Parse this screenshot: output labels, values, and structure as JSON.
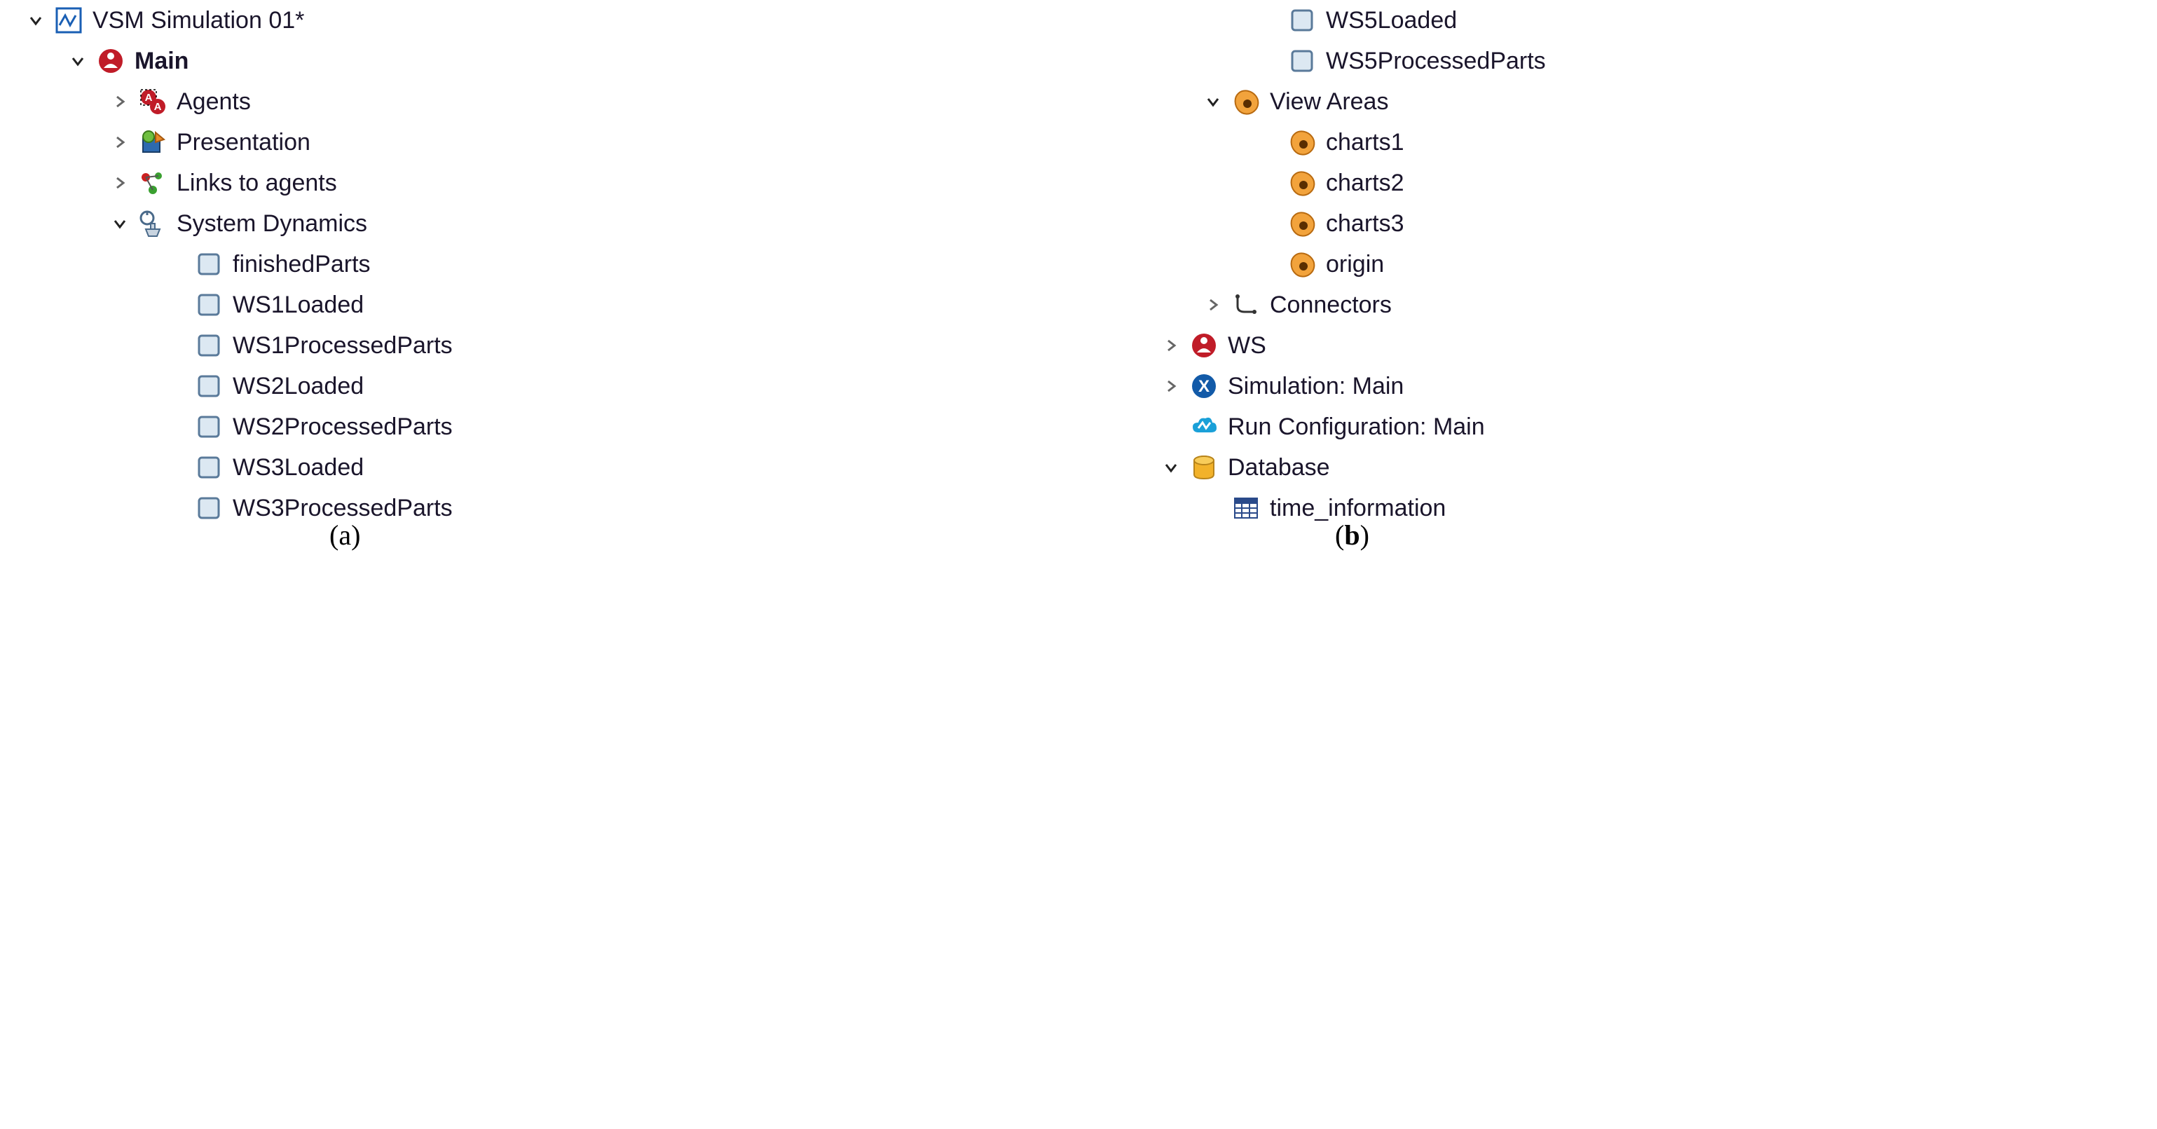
{
  "left": {
    "project": "VSM Simulation 01*",
    "main": "Main",
    "agents": "Agents",
    "presentation": "Presentation",
    "links": "Links to agents",
    "sysdyn": "System Dynamics",
    "vars": {
      "v0": "finishedParts",
      "v1": "WS1Loaded",
      "v2": "WS1ProcessedParts",
      "v3": "WS2Loaded",
      "v4": "WS2ProcessedParts",
      "v5": "WS3Loaded",
      "v6": "WS3ProcessedParts"
    }
  },
  "right": {
    "vars": {
      "v0": "WS5Loaded",
      "v1": "WS5ProcessedParts"
    },
    "viewareas": "View Areas",
    "charts": {
      "c0": "charts1",
      "c1": "charts2",
      "c2": "charts3",
      "c3": "origin"
    },
    "connectors": "Connectors",
    "ws": "WS",
    "sim": "Simulation: Main",
    "runcfg": "Run Configuration: Main",
    "db": "Database",
    "table": "time_information"
  },
  "sub": {
    "a": "(a)",
    "b": "(b)"
  }
}
